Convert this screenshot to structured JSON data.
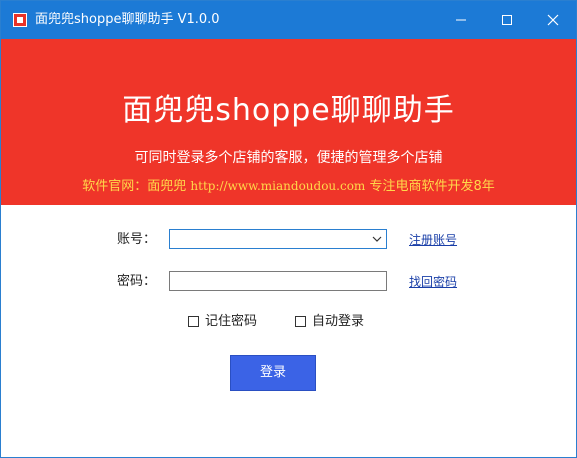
{
  "window": {
    "title": "面兜兜shoppe聊聊助手 V1.0.0"
  },
  "banner": {
    "title": "面兜兜shoppe聊聊助手",
    "subtitle": "可同时登录多个店铺的客服，便捷的管理多个店铺",
    "site_prefix": "软件官网：面兜兜",
    "site_url": "http://www.miandoudou.com",
    "site_suffix": "专注电商软件开发8年"
  },
  "form": {
    "account_label": "账号：",
    "account_value": "",
    "register_link": "注册账号",
    "password_label": "密码：",
    "password_value": "",
    "recover_link": "找回密码",
    "remember_label": "记住密码",
    "remember_checked": false,
    "autologin_label": "自动登录",
    "autologin_checked": false,
    "login_label": "登录"
  },
  "colors": {
    "titlebar": "#1c7ad6",
    "banner": "#ef3529",
    "site_text": "#ffd84a",
    "login_button": "#3b63e6",
    "link": "#1a3fa8"
  },
  "icons": {
    "app": "app-logo-icon",
    "minimize": "minimize-icon",
    "maximize": "maximize-icon",
    "close": "close-icon",
    "dropdown": "chevron-down-icon"
  }
}
